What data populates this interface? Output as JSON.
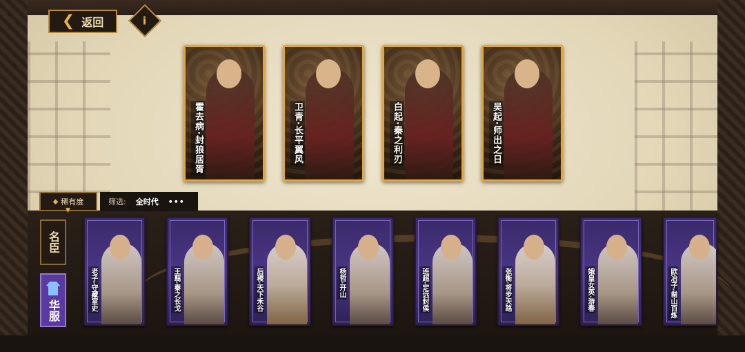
{
  "header": {
    "back_label": "返回",
    "info_label": "i"
  },
  "featured_cards": [
    {
      "name": "霍去病",
      "title": "封狼居胥"
    },
    {
      "name": "卫青",
      "title": "长平翼风"
    },
    {
      "name": "白起",
      "title": "秦之利刃"
    },
    {
      "name": "吴起",
      "title": "师出之日"
    }
  ],
  "filter": {
    "rarity_label": "稀有度",
    "filter_prefix": "筛选:",
    "filter_value": "全时代",
    "more": "•••"
  },
  "side_tabs": {
    "tab_a": "名臣",
    "tab_b": "华服"
  },
  "cards": [
    {
      "name": "老子",
      "title": "守藏室史"
    },
    {
      "name": "王翦",
      "title": "秦之长戈"
    },
    {
      "name": "后稷",
      "title": "天下禾谷"
    },
    {
      "name": "杨哲",
      "title": "开山"
    },
    {
      "name": "班超",
      "title": "定远封侯"
    },
    {
      "name": "张衡",
      "title": "将步天路"
    },
    {
      "name": "娥皇女英",
      "title": "游春"
    },
    {
      "name": "欧冶子",
      "title": "凿山百炼"
    }
  ],
  "colors": {
    "gold_border": "#e4a63a",
    "card_purple": "#4a3684",
    "accent_gold": "#e6b24a"
  }
}
